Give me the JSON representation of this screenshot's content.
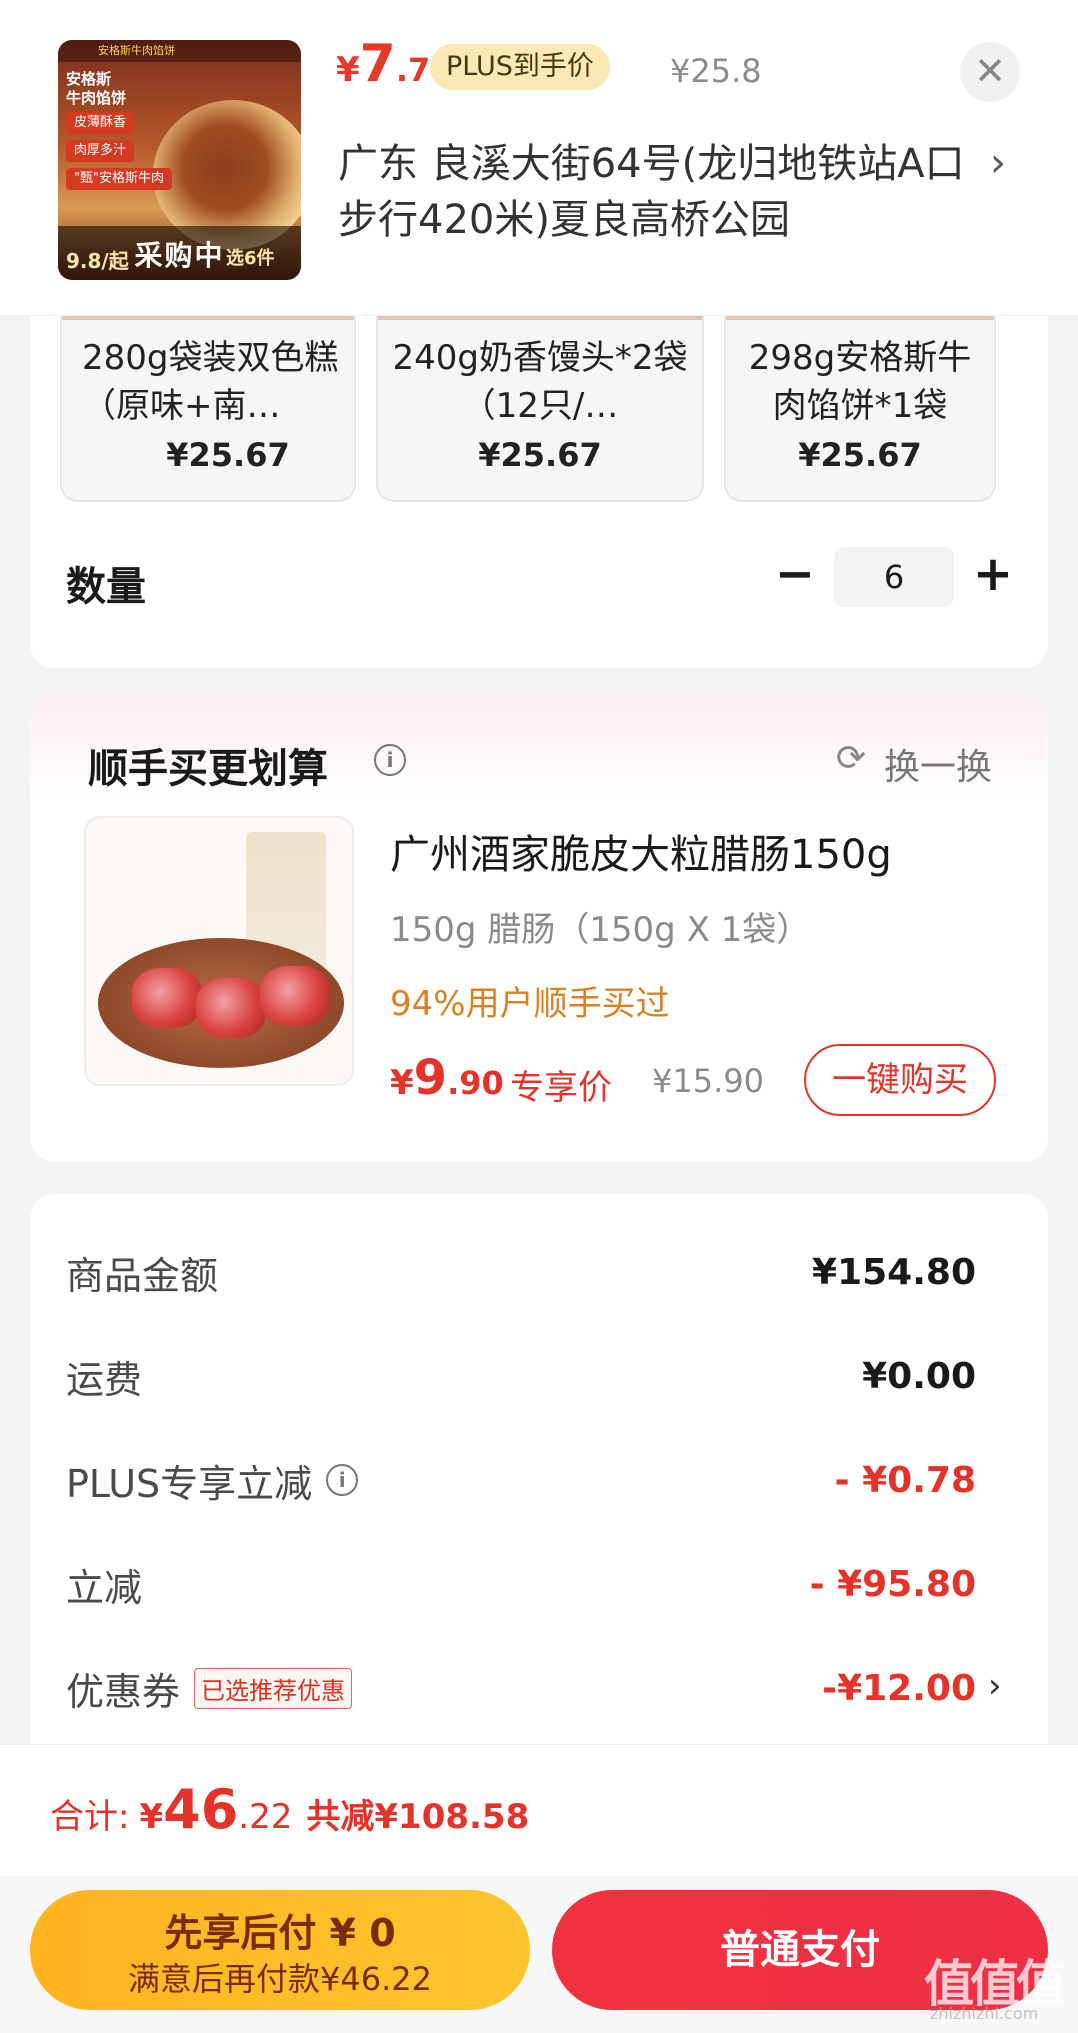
{
  "header": {
    "product_image": {
      "brand_strip": "安格斯牛肉馅饼",
      "title": "安格斯\n牛肉馅饼",
      "tags": [
        "皮薄酥香",
        "肉厚多汁",
        "\"甄\"安格斯牛肉"
      ],
      "overlay_label": "采购中",
      "mini_price": "9.8/起",
      "mini_select": "选6件"
    },
    "price_symbol": "¥",
    "price_int": "7",
    "price_dec": ".7",
    "plus_badge": "PLUS到手价",
    "orig_price": "¥25.8",
    "close_symbol": "✕",
    "address": "广东  良溪大街64号(龙归地铁站A口步行420米)夏良高桥公园",
    "address_chevron": "›"
  },
  "specs": [
    {
      "name": "280g袋装双色糕（原味+南…",
      "price": "¥25.67"
    },
    {
      "name": "240g奶香馒头*2袋（12只/…",
      "price": "¥25.67"
    },
    {
      "name": "298g安格斯牛肉馅饼*1袋",
      "price": "¥25.67"
    }
  ],
  "quantity": {
    "label": "数量",
    "minus": "−",
    "value": "6",
    "plus": "+"
  },
  "recommend": {
    "title": "顺手买更划算",
    "refresh_label": "换一换",
    "item": {
      "name": "广州酒家脆皮大粒腊肠150g",
      "spec": "150g 腊肠（150g X 1袋）",
      "bought": "94%用户顺手买过",
      "price_symbol": "¥",
      "price_int": "9",
      "price_dec": ".90",
      "exclusive_label": "专享价",
      "orig_price": "¥15.90",
      "buy_label": "一键购买"
    }
  },
  "summary": {
    "rows": [
      {
        "label": "商品金额",
        "value": "¥154.80"
      },
      {
        "label": "运费",
        "value": "¥0.00"
      },
      {
        "label": "PLUS专享立减",
        "value": "- ¥0.78"
      },
      {
        "label": "立减",
        "value": "- ¥95.80"
      },
      {
        "label": "优惠券",
        "tag": "已选推荐优惠",
        "value": "-¥12.00"
      }
    ],
    "coupon_chevron": "›"
  },
  "footer": {
    "total_label": "合计:",
    "total_symbol": "¥",
    "total_int": "46",
    "total_dec": ".22",
    "saved": "共减¥108.58",
    "pay_later_line1": "先享后付 ¥ 0",
    "pay_later_line2": "满意后再付款¥46.22",
    "pay_normal": "普通支付"
  },
  "watermark": {
    "text": "值值值",
    "sub": "zhizhizhi.com"
  },
  "colors": {
    "accent_red": "#e5332a",
    "plus_gold": "#fbe9b5",
    "pay_later_yellow": "#ffb320",
    "orange_text": "#d98222"
  },
  "icons": [
    "close-icon",
    "chevron-right-icon",
    "info-icon",
    "refresh-icon",
    "minus-icon",
    "plus-icon"
  ]
}
